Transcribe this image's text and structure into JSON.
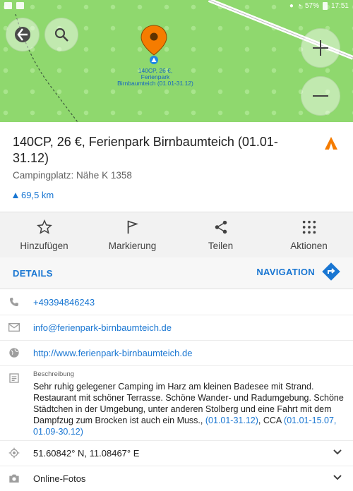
{
  "status_bar": {
    "battery": "57%",
    "time": "17:51"
  },
  "map": {
    "poi_label_lines": [
      "140CP, 26 €,",
      "Ferienpark",
      "Birnbaumteich (01.01-31.12)"
    ],
    "buttons": [
      "back-compass-icon",
      "search-icon",
      "zoom-in-icon",
      "zoom-out-icon"
    ]
  },
  "place": {
    "title": "140CP, 26 €, Ferienpark Birnbaumteich (01.01-31.12)",
    "subtitle": "Campingplatz: Nähe K 1358",
    "distance": "69,5 km"
  },
  "actions": [
    {
      "label": "Hinzufügen",
      "icon": "star-outline-icon"
    },
    {
      "label": "Markierung",
      "icon": "flag-icon"
    },
    {
      "label": "Teilen",
      "icon": "share-icon"
    },
    {
      "label": "Aktionen",
      "icon": "grid-dots-icon"
    }
  ],
  "tabs": {
    "details": "DETAILS",
    "navigation": "NAVIGATION"
  },
  "details": {
    "phone": "+49394846243",
    "email": "info@ferienpark-birnbaumteich.de",
    "website": "http://www.ferienpark-birnbaumteich.de",
    "description_label": "Beschreibung",
    "description_text": "Sehr ruhig gelegener Camping im Harz am kleinen Badesee mit Strand. Restaurant mit schöner Terrasse. Schöne Wander- und Radumgebung. Schöne Städtchen in der Umgebung, unter anderen Stolberg und eine Fahrt mit dem Dampfzug zum Brocken ist auch ein Muss., ",
    "description_link1": "(01.01-31.12)",
    "description_mid": ", CCA ",
    "description_link2": "(01.01-15.07, 01.09-30.12)",
    "coordinates": "51.60842° N, 11.08467° E",
    "photos": "Online-Fotos"
  },
  "colors": {
    "accent": "#1976d2",
    "pin": "#f57c00",
    "map_green": "#8fd86e"
  }
}
